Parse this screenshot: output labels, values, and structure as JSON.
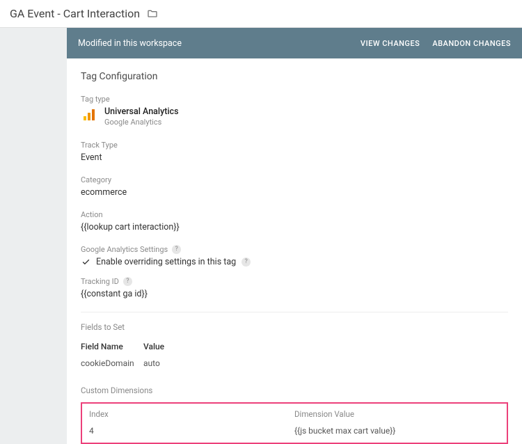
{
  "topbar": {
    "title": "GA Event - Cart Interaction"
  },
  "banner": {
    "message": "Modified in this workspace",
    "view_changes": "VIEW CHANGES",
    "abandon_changes": "ABANDON CHANGES"
  },
  "card": {
    "title": "Tag Configuration",
    "tag_type_label": "Tag type",
    "tag_type_name": "Universal Analytics",
    "tag_type_sub": "Google Analytics",
    "track_type_label": "Track Type",
    "track_type_value": "Event",
    "category_label": "Category",
    "category_value": "ecommerce",
    "action_label": "Action",
    "action_value": "{{lookup cart interaction}}",
    "ga_settings_label": "Google Analytics Settings",
    "override_label": "Enable overriding settings in this tag",
    "tracking_id_label": "Tracking ID",
    "tracking_id_value": "{{constant ga id}}",
    "fields_to_set_label": "Fields to Set",
    "fields_to_set_header_name": "Field Name",
    "fields_to_set_header_value": "Value",
    "fields_to_set_rows": [
      {
        "name": "cookieDomain",
        "value": "auto"
      }
    ],
    "custom_dimensions_label": "Custom Dimensions",
    "dim_header_index": "Index",
    "dim_header_value": "Dimension Value",
    "dim_rows": [
      {
        "index": "4",
        "value": "{{js bucket max cart value}}"
      }
    ]
  }
}
